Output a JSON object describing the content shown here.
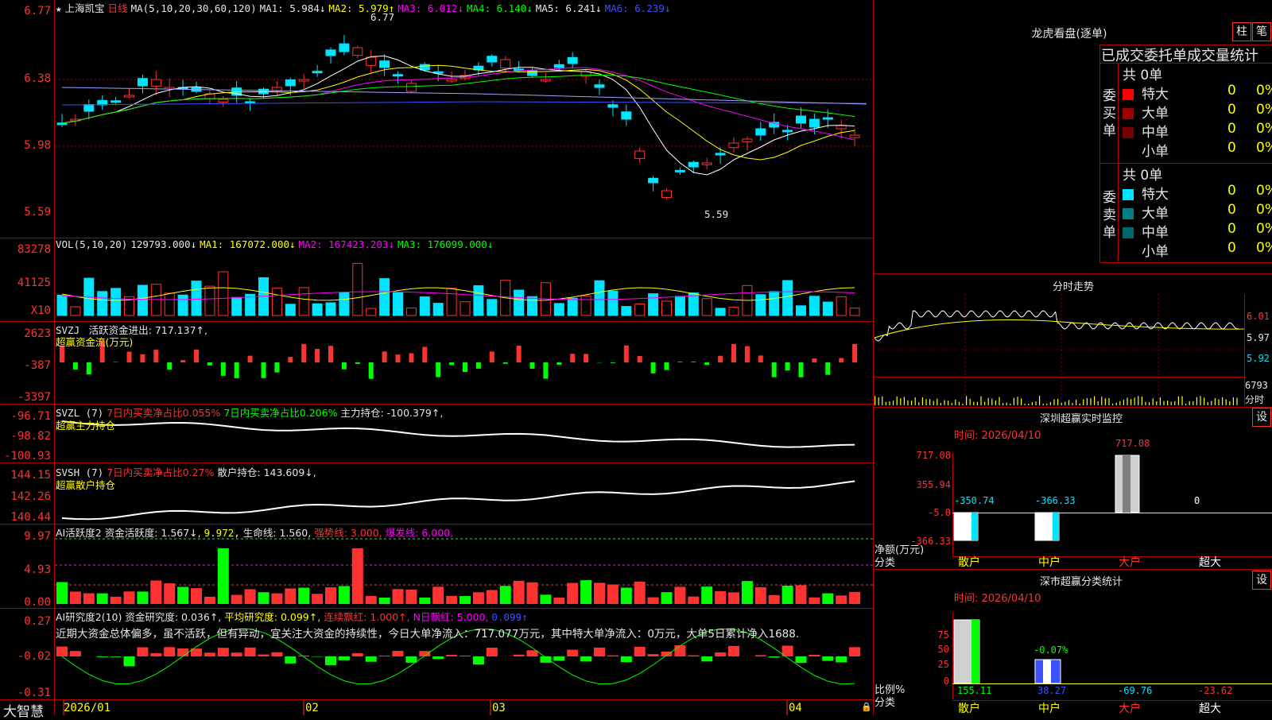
{
  "stock": {
    "name_star": "★",
    "name": "上海凯宝",
    "period": "日线"
  },
  "ma_header": {
    "label": "MA(5,10,20,30,60,120)",
    "ma1": "MA1: 5.984↓",
    "ma2": "MA2: 5.979↑",
    "ma3": "MA3: 6.012↓",
    "ma4": "MA4: 6.140↓",
    "ma5": "MA5: 6.241↓",
    "ma6": "MA6: 6.239↓"
  },
  "price_axis": [
    "6.77",
    "6.38",
    "5.98",
    "5.59"
  ],
  "price_marks": {
    "high": "6.77",
    "low": "5.59"
  },
  "vol_header": {
    "label": "VOL(5,10,20)",
    "v": "129793.000↓",
    "ma1": "MA1: 167072.000↓",
    "ma2": "MA2: 167423.203↓",
    "ma3": "MA3: 176099.000↓"
  },
  "vol_axis": [
    "83278",
    "41125",
    "X10"
  ],
  "svzj": {
    "label": "SVZJ",
    "text": "活跃资金进出: 717.137↑,",
    "subtitle": "超赢资金流(万元)",
    "axis": [
      "2623",
      "-387",
      "-3397"
    ]
  },
  "svzl": {
    "label": "SVZL (7)",
    "a": "7日内买卖净占比0.055%",
    "b": "7日内买卖净占比0.206%",
    "c": "主力持仓: -100.379↑,",
    "subtitle": "超赢主力持仓",
    "axis": [
      "-96.71",
      "-98.82",
      "-100.93"
    ]
  },
  "svsh": {
    "label": "SVSH (7)",
    "a": "7日内买卖净占比0.27%",
    "b": "散户持仓: 143.609↓,",
    "subtitle": "超赢散户持仓",
    "axis": [
      "144.15",
      "142.26",
      "140.44"
    ]
  },
  "ai1": {
    "label": "AI活跃度2",
    "a": "资金活跃度: 1.567↓,",
    "b": "9.972,",
    "c": "生命线: 1.560,",
    "d": "强势线: 3.000,",
    "e": "爆发线: 6.000,",
    "axis": [
      "9.97",
      "4.93",
      "0.00"
    ]
  },
  "ai2": {
    "label": "AI研究度2(10)",
    "a": "资金研究度: 0.036↑,",
    "b": "平均研究度: 0.099↑,",
    "c": "连续飘红: 1.000↑,",
    "d": "N日飘红: 5.000,",
    "e": "0.099↑",
    "axis": [
      "0.27",
      "-0.02",
      "-0.31"
    ],
    "comment": "近期大资金总体偏多，虽不活跃，但有异动，宜关注大资金的持续性，今日大单净流入：717.077万元，其中特大单净流入：0万元，大单5日累计净入1688."
  },
  "date_axis": {
    "brand": "大智慧",
    "d1": "2026/01",
    "d2": "02",
    "d3": "03",
    "d4": "04"
  },
  "longhu": {
    "title": "龙虎看盘(逐单)",
    "btn1": "柱",
    "btn2": "笔",
    "subtitle": "已成交委托单成交量统计",
    "buy_label": "委买单",
    "sell_label": "委卖单",
    "buy_total": "共 0单",
    "sell_total": "共 0单",
    "buy_rows": [
      {
        "name": "特大",
        "v": "0",
        "p": "0%"
      },
      {
        "name": "大单",
        "v": "0",
        "p": "0%"
      },
      {
        "name": "中单",
        "v": "0",
        "p": "0%"
      },
      {
        "name": "小单",
        "v": "0",
        "p": "0%"
      }
    ],
    "sell_rows": [
      {
        "name": "特大",
        "v": "0",
        "p": "0%"
      },
      {
        "name": "大单",
        "v": "0",
        "p": "0%"
      },
      {
        "name": "中单",
        "v": "0",
        "p": "0%"
      },
      {
        "name": "小单",
        "v": "0",
        "p": "0%"
      }
    ]
  },
  "fenshi": {
    "title": "分时走势",
    "axis": [
      "6.01",
      "5.97",
      "5.92",
      "6793",
      "分时"
    ]
  },
  "monitor": {
    "title": "深圳超赢实时监控",
    "btn": "设",
    "time": "时间: 2026/04/10",
    "axis": [
      "717.08",
      "355.94",
      "-5.0",
      "-366.33"
    ],
    "bars": [
      {
        "cat": "散户",
        "v": "-350.74"
      },
      {
        "cat": "中户",
        "v": "-366.33"
      },
      {
        "cat": "大户",
        "v": "717.08"
      },
      {
        "cat": "超大",
        "v": "0"
      }
    ],
    "ylab1": "净额(万元)",
    "ylab2": "分类"
  },
  "classify": {
    "title": "深市超赢分类统计",
    "btn": "设",
    "time": "时间: 2026/04/10",
    "axis": [
      "75",
      "50",
      "25",
      "0"
    ],
    "bars": [
      {
        "cat": "散户",
        "v": "155.11"
      },
      {
        "cat": "中户",
        "v": "38.27"
      },
      {
        "cat": "大户",
        "v": "-69.76"
      },
      {
        "cat": "超大",
        "v": "-23.62"
      }
    ],
    "top_label": "-0.07%",
    "ylab1": "比例%",
    "ylab2": "分类"
  }
}
